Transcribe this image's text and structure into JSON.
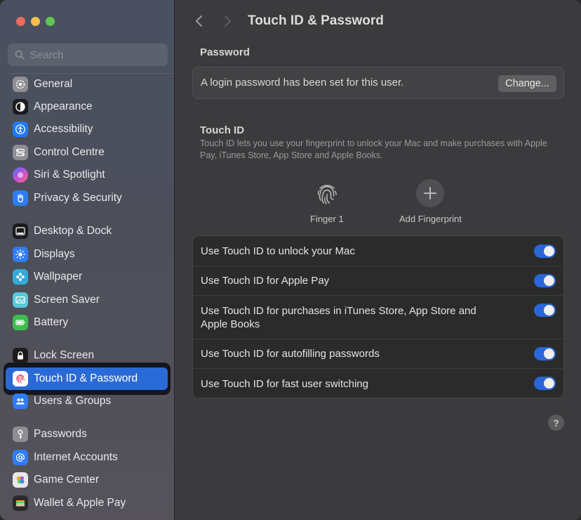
{
  "window": {
    "title": "Touch ID & Password"
  },
  "search": {
    "placeholder": "Search"
  },
  "sidebar": {
    "items": [
      {
        "label": "General",
        "icon": "gear-icon",
        "color": "#8e8e93"
      },
      {
        "label": "Appearance",
        "icon": "appearance-icon",
        "color": "#1c1c1e"
      },
      {
        "label": "Accessibility",
        "icon": "accessibility-icon",
        "color": "#1f7bf2"
      },
      {
        "label": "Control Centre",
        "icon": "control-centre-icon",
        "color": "#8e8e93"
      },
      {
        "label": "Siri & Spotlight",
        "icon": "siri-icon",
        "color": "#b14fd6"
      },
      {
        "label": "Privacy & Security",
        "icon": "hand-icon",
        "color": "#2f7cf6"
      },
      {
        "label": "Desktop & Dock",
        "icon": "dock-icon",
        "color": "#1c1c1e"
      },
      {
        "label": "Displays",
        "icon": "sun-icon",
        "color": "#2f7cf6"
      },
      {
        "label": "Wallpaper",
        "icon": "wallpaper-icon",
        "color": "#34aadc"
      },
      {
        "label": "Screen Saver",
        "icon": "screen-saver-icon",
        "color": "#5ac8d8"
      },
      {
        "label": "Battery",
        "icon": "battery-icon",
        "color": "#3ebd4e"
      },
      {
        "label": "Lock Screen",
        "icon": "lock-icon",
        "color": "#1c1c1e"
      },
      {
        "label": "Touch ID & Password",
        "icon": "fingerprint-icon",
        "color": "#ffffff"
      },
      {
        "label": "Users & Groups",
        "icon": "users-icon",
        "color": "#2f7cf6"
      },
      {
        "label": "Passwords",
        "icon": "key-icon",
        "color": "#8e8e93"
      },
      {
        "label": "Internet Accounts",
        "icon": "at-icon",
        "color": "#2f7cf6"
      },
      {
        "label": "Game Center",
        "icon": "game-center-icon",
        "color": "#e8e8e8"
      },
      {
        "label": "Wallet & Apple Pay",
        "icon": "wallet-icon",
        "color": "#2a2a2a"
      }
    ],
    "active_index": 12
  },
  "password": {
    "section_title": "Password",
    "status_text": "A login password has been set for this user.",
    "change_label": "Change..."
  },
  "touch_id": {
    "section_title": "Touch ID",
    "description": "Touch ID lets you use your fingerprint to unlock your Mac and make purchases with Apple Pay, iTunes Store, App Store and Apple Books.",
    "finger_label": "Finger 1",
    "add_label": "Add Fingerprint",
    "toggles": [
      {
        "label": "Use Touch ID to unlock your Mac",
        "on": true
      },
      {
        "label": "Use Touch ID for Apple Pay",
        "on": true
      },
      {
        "label": "Use Touch ID for purchases in iTunes Store, App Store and Apple Books",
        "on": true
      },
      {
        "label": "Use Touch ID for autofilling passwords",
        "on": true
      },
      {
        "label": "Use Touch ID for fast user switching",
        "on": true
      }
    ]
  },
  "help": {
    "label": "?"
  },
  "colors": {
    "accent": "#2a6ad6",
    "toggle_on": "#2b66d9"
  }
}
